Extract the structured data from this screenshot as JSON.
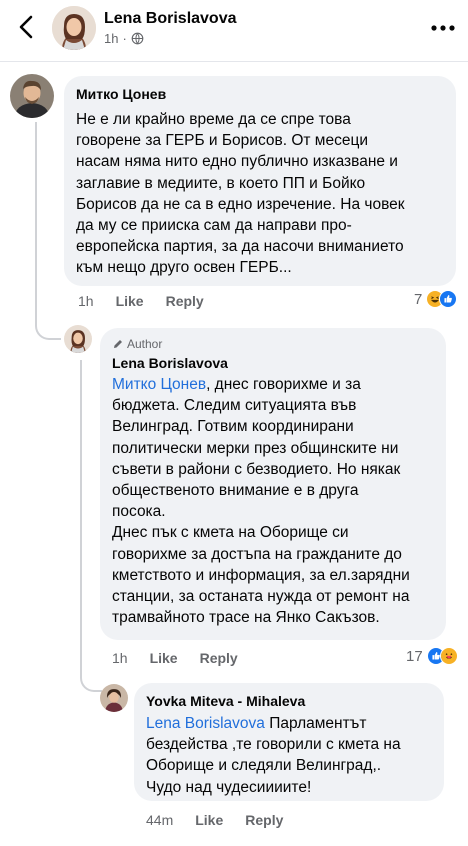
{
  "header": {
    "name": "Lena Borislavova",
    "time": "1h",
    "separator": "·",
    "back_icon": "chevron-left-icon",
    "privacy_icon": "globe-icon",
    "more_icon": "ellipsis-icon"
  },
  "comments": [
    {
      "author": "Митко Цонев",
      "text": "Не е ли крайно време да се спре това говорене за ГЕРБ и Борисов. От месеци насам няма нито едно публично изказване и заглавие в медиите, в което ПП и Бойко Борисов да не са в едно изречение. На човек да му се прииска сам да направи про-европейска партия, за да насочи вниманието към нещо друго освен ГЕРБ...",
      "lines": [
        "Не е ли крайно време да се спре това",
        "говорене за ГЕРБ и Борисов. От месеци",
        "насам няма нито едно публично изказване и",
        "заглавие в медиите, в което ПП и Бойко",
        "Борисов да не са в едно изречение. На човек",
        "да му се прииска сам да направи про-",
        "европейска партия, за да насочи вниманието",
        "към нещо друго освен ГЕРБ..."
      ],
      "time": "1h",
      "like": "Like",
      "reply": "Reply",
      "reaction_count": "7",
      "reactions": [
        "haha",
        "like"
      ]
    },
    {
      "badge": "Author",
      "author": "Lena Borislavova",
      "mention": "Митко Цонев",
      "lines": [
        ", днес говорихме и за",
        "бюджета. Следим ситуацията във",
        "Велинград. Готвим координирани",
        "политически мерки през общинските ни",
        "съвети в райони с безводието. Но някак",
        "общественото внимание е в друга",
        "посока.",
        "Днес пък с кмета на Оборище си",
        "говорихме за достъпа на гражданите до",
        "кметството и информация, за ел.зарядни",
        "станции, за останата нужда от ремонт на",
        "трамвайното трасе на Янко Сакъзов."
      ],
      "time": "1h",
      "like": "Like",
      "reply": "Reply",
      "reaction_count": "17",
      "reactions": [
        "like",
        "love"
      ]
    },
    {
      "author": "Yovka Miteva - Mihaleva",
      "mention": "Lena Borislavova",
      "lines": [
        " Парламентът",
        "бездейства ,те говорили с кмета на",
        "Оборище и следяли Велинград,.",
        "Чудо над чудесиииите!"
      ],
      "time": "44m",
      "like": "Like",
      "reply": "Reply"
    }
  ],
  "colors": {
    "bubble": "#f0f2f5",
    "mention": "#216fdb",
    "meta": "#65676b",
    "like": "#1877f2",
    "love": "#f33e58",
    "haha": "#f7b125"
  }
}
